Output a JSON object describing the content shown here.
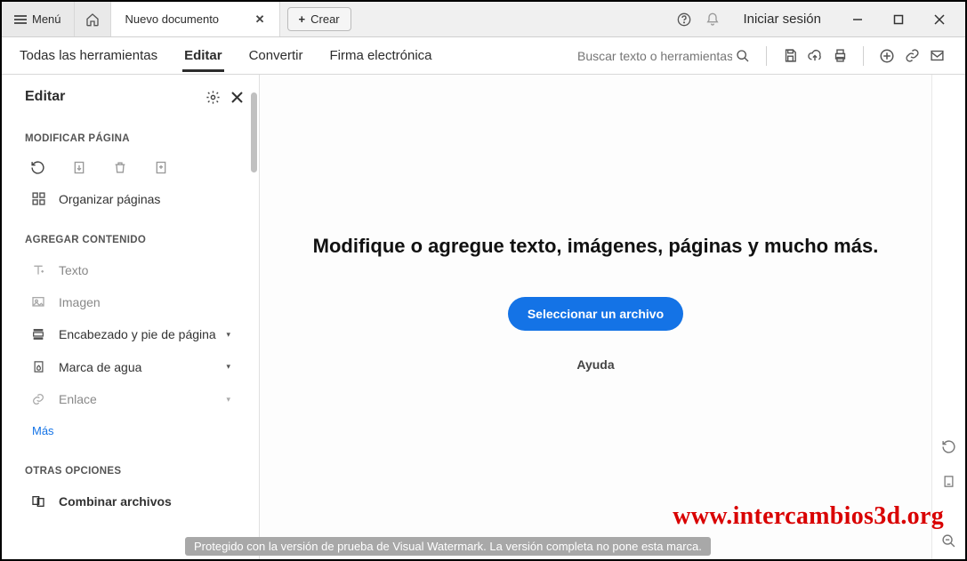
{
  "titlebar": {
    "menu_label": "Menú",
    "tab_title": "Nuevo documento",
    "create_label": "Crear",
    "signin_label": "Iniciar sesión"
  },
  "toolbar": {
    "tabs": {
      "all": "Todas las herramientas",
      "edit": "Editar",
      "convert": "Convertir",
      "sign": "Firma electrónica"
    },
    "search_placeholder": "Buscar texto o herramientas"
  },
  "sidebar": {
    "title": "Editar",
    "section_modify": "MODIFICAR PÁGINA",
    "organize": "Organizar páginas",
    "section_add": "AGREGAR CONTENIDO",
    "text": "Texto",
    "image": "Imagen",
    "header_footer": "Encabezado y pie de página",
    "watermark": "Marca de agua",
    "link": "Enlace",
    "more": "Más",
    "section_other": "OTRAS OPCIONES",
    "combine": "Combinar archivos"
  },
  "content": {
    "headline": "Modifique o agregue texto, imágenes, páginas y mucho más.",
    "select_file": "Seleccionar un archivo",
    "help": "Ayuda"
  },
  "footer": {
    "watermark_bar": "Protegido con la versión de prueba de Visual Watermark. La versión completa no pone esta marca.",
    "site": "www.intercambios3d.org"
  }
}
